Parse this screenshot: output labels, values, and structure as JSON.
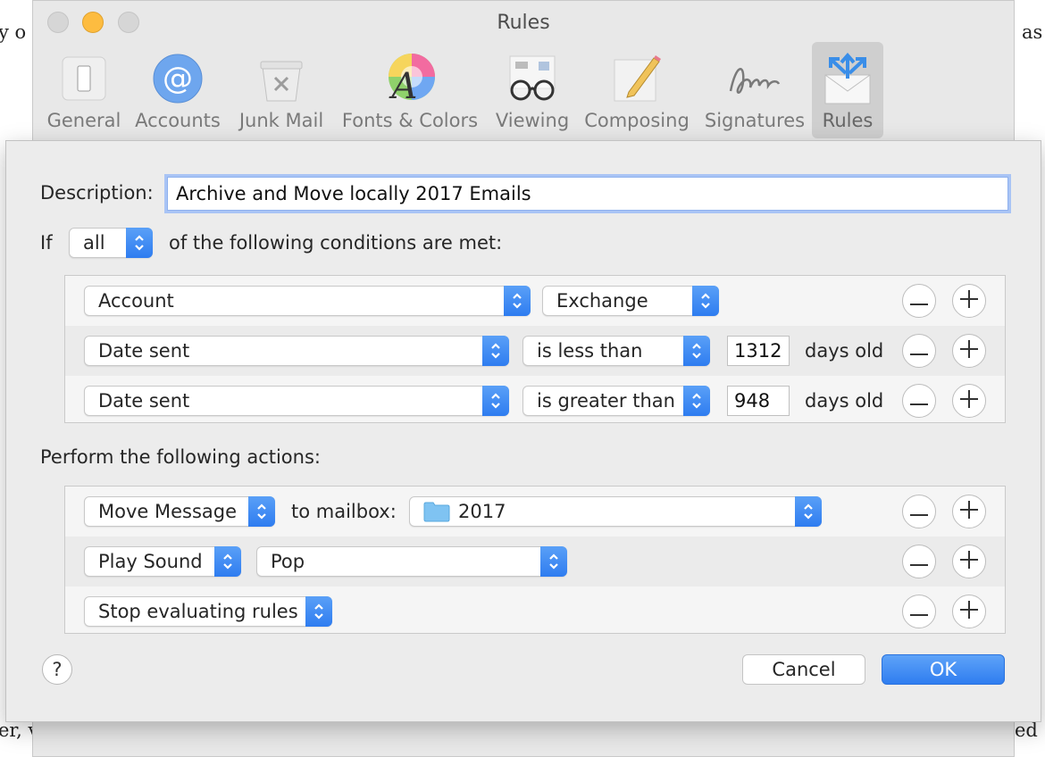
{
  "window": {
    "title": "Rules"
  },
  "toolbar": {
    "items": [
      {
        "label": "General",
        "icon": "switch-icon"
      },
      {
        "label": "Accounts",
        "icon": "at-sign-icon"
      },
      {
        "label": "Junk Mail",
        "icon": "trash-bin-icon"
      },
      {
        "label": "Fonts & Colors",
        "icon": "font-color-icon"
      },
      {
        "label": "Viewing",
        "icon": "glasses-icon"
      },
      {
        "label": "Composing",
        "icon": "pencil-note-icon"
      },
      {
        "label": "Signatures",
        "icon": "signature-icon"
      },
      {
        "label": "Rules",
        "icon": "rules-envelope-icon",
        "active": true
      }
    ]
  },
  "sheet": {
    "description_label": "Description:",
    "description_value": "Archive and Move locally 2017 Emails",
    "if_label": "If",
    "match_selector": "all",
    "conditions_label": "of the following conditions are met:",
    "conditions": [
      {
        "field": "Account",
        "operator": "Exchange",
        "value": "",
        "unit": ""
      },
      {
        "field": "Date sent",
        "operator": "is less than",
        "value": "1312",
        "unit": "days old"
      },
      {
        "field": "Date sent",
        "operator": "is greater than",
        "value": "948",
        "unit": "days old"
      }
    ],
    "actions_label": "Perform the following actions:",
    "actions": [
      {
        "action": "Move Message",
        "connector": "to mailbox:",
        "target": "2017"
      },
      {
        "action": "Play Sound",
        "target": "Pop"
      },
      {
        "action": "Stop evaluating rules"
      }
    ],
    "help_label": "?",
    "cancel_label": "Cancel",
    "ok_label": "OK"
  },
  "background_text": {
    "left_fragment": "y o",
    "right_fragment": "} as",
    "bottom_fragment": "er, v",
    "bottom_right_fragment": "ed"
  },
  "colors": {
    "accent": "#2f7df0",
    "window": "#e8e8e8",
    "sheet": "#ececec"
  }
}
